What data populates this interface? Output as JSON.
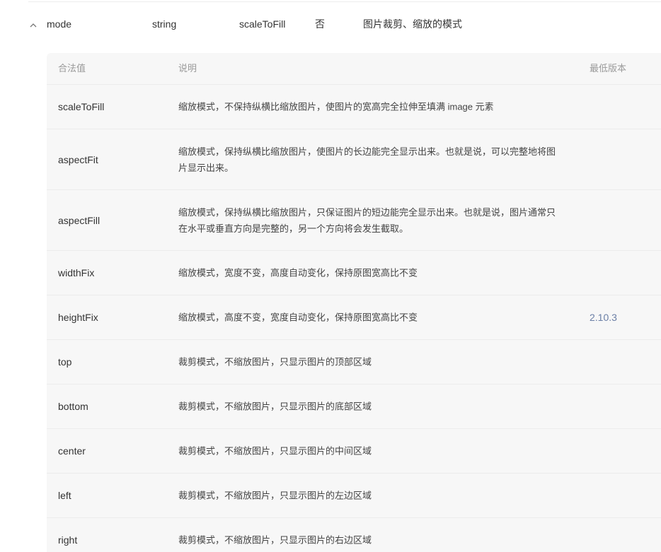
{
  "property": {
    "name": "mode",
    "type": "string",
    "default": "scaleToFill",
    "required": "否",
    "description": "图片裁剪、缩放的模式"
  },
  "icons": {
    "collapse": "chevron-up-icon"
  },
  "values_table": {
    "headers": {
      "value": "合法值",
      "description": "说明",
      "min_version": "最低版本"
    },
    "rows": [
      {
        "value": "scaleToFill",
        "description": "缩放模式，不保持纵横比缩放图片，使图片的宽高完全拉伸至填满 image 元素",
        "min_version": ""
      },
      {
        "value": "aspectFit",
        "description": "缩放模式，保持纵横比缩放图片，使图片的长边能完全显示出来。也就是说，可以完整地将图片显示出来。",
        "min_version": ""
      },
      {
        "value": "aspectFill",
        "description": "缩放模式，保持纵横比缩放图片，只保证图片的短边能完全显示出来。也就是说，图片通常只在水平或垂直方向是完整的，另一个方向将会发生截取。",
        "min_version": ""
      },
      {
        "value": "widthFix",
        "description": "缩放模式，宽度不变，高度自动变化，保持原图宽高比不变",
        "min_version": ""
      },
      {
        "value": "heightFix",
        "description": "缩放模式，高度不变，宽度自动变化，保持原图宽高比不变",
        "min_version": "2.10.3"
      },
      {
        "value": "top",
        "description": "裁剪模式，不缩放图片，只显示图片的顶部区域",
        "min_version": ""
      },
      {
        "value": "bottom",
        "description": "裁剪模式，不缩放图片，只显示图片的底部区域",
        "min_version": ""
      },
      {
        "value": "center",
        "description": "裁剪模式，不缩放图片，只显示图片的中间区域",
        "min_version": ""
      },
      {
        "value": "left",
        "description": "裁剪模式，不缩放图片，只显示图片的左边区域",
        "min_version": ""
      },
      {
        "value": "right",
        "description": "裁剪模式，不缩放图片，只显示图片的右边区域",
        "min_version": ""
      }
    ]
  },
  "colors": {
    "panel_background": "#f7f7f7",
    "version_link": "#6b7fa6",
    "header_text": "#9a9a9a"
  }
}
